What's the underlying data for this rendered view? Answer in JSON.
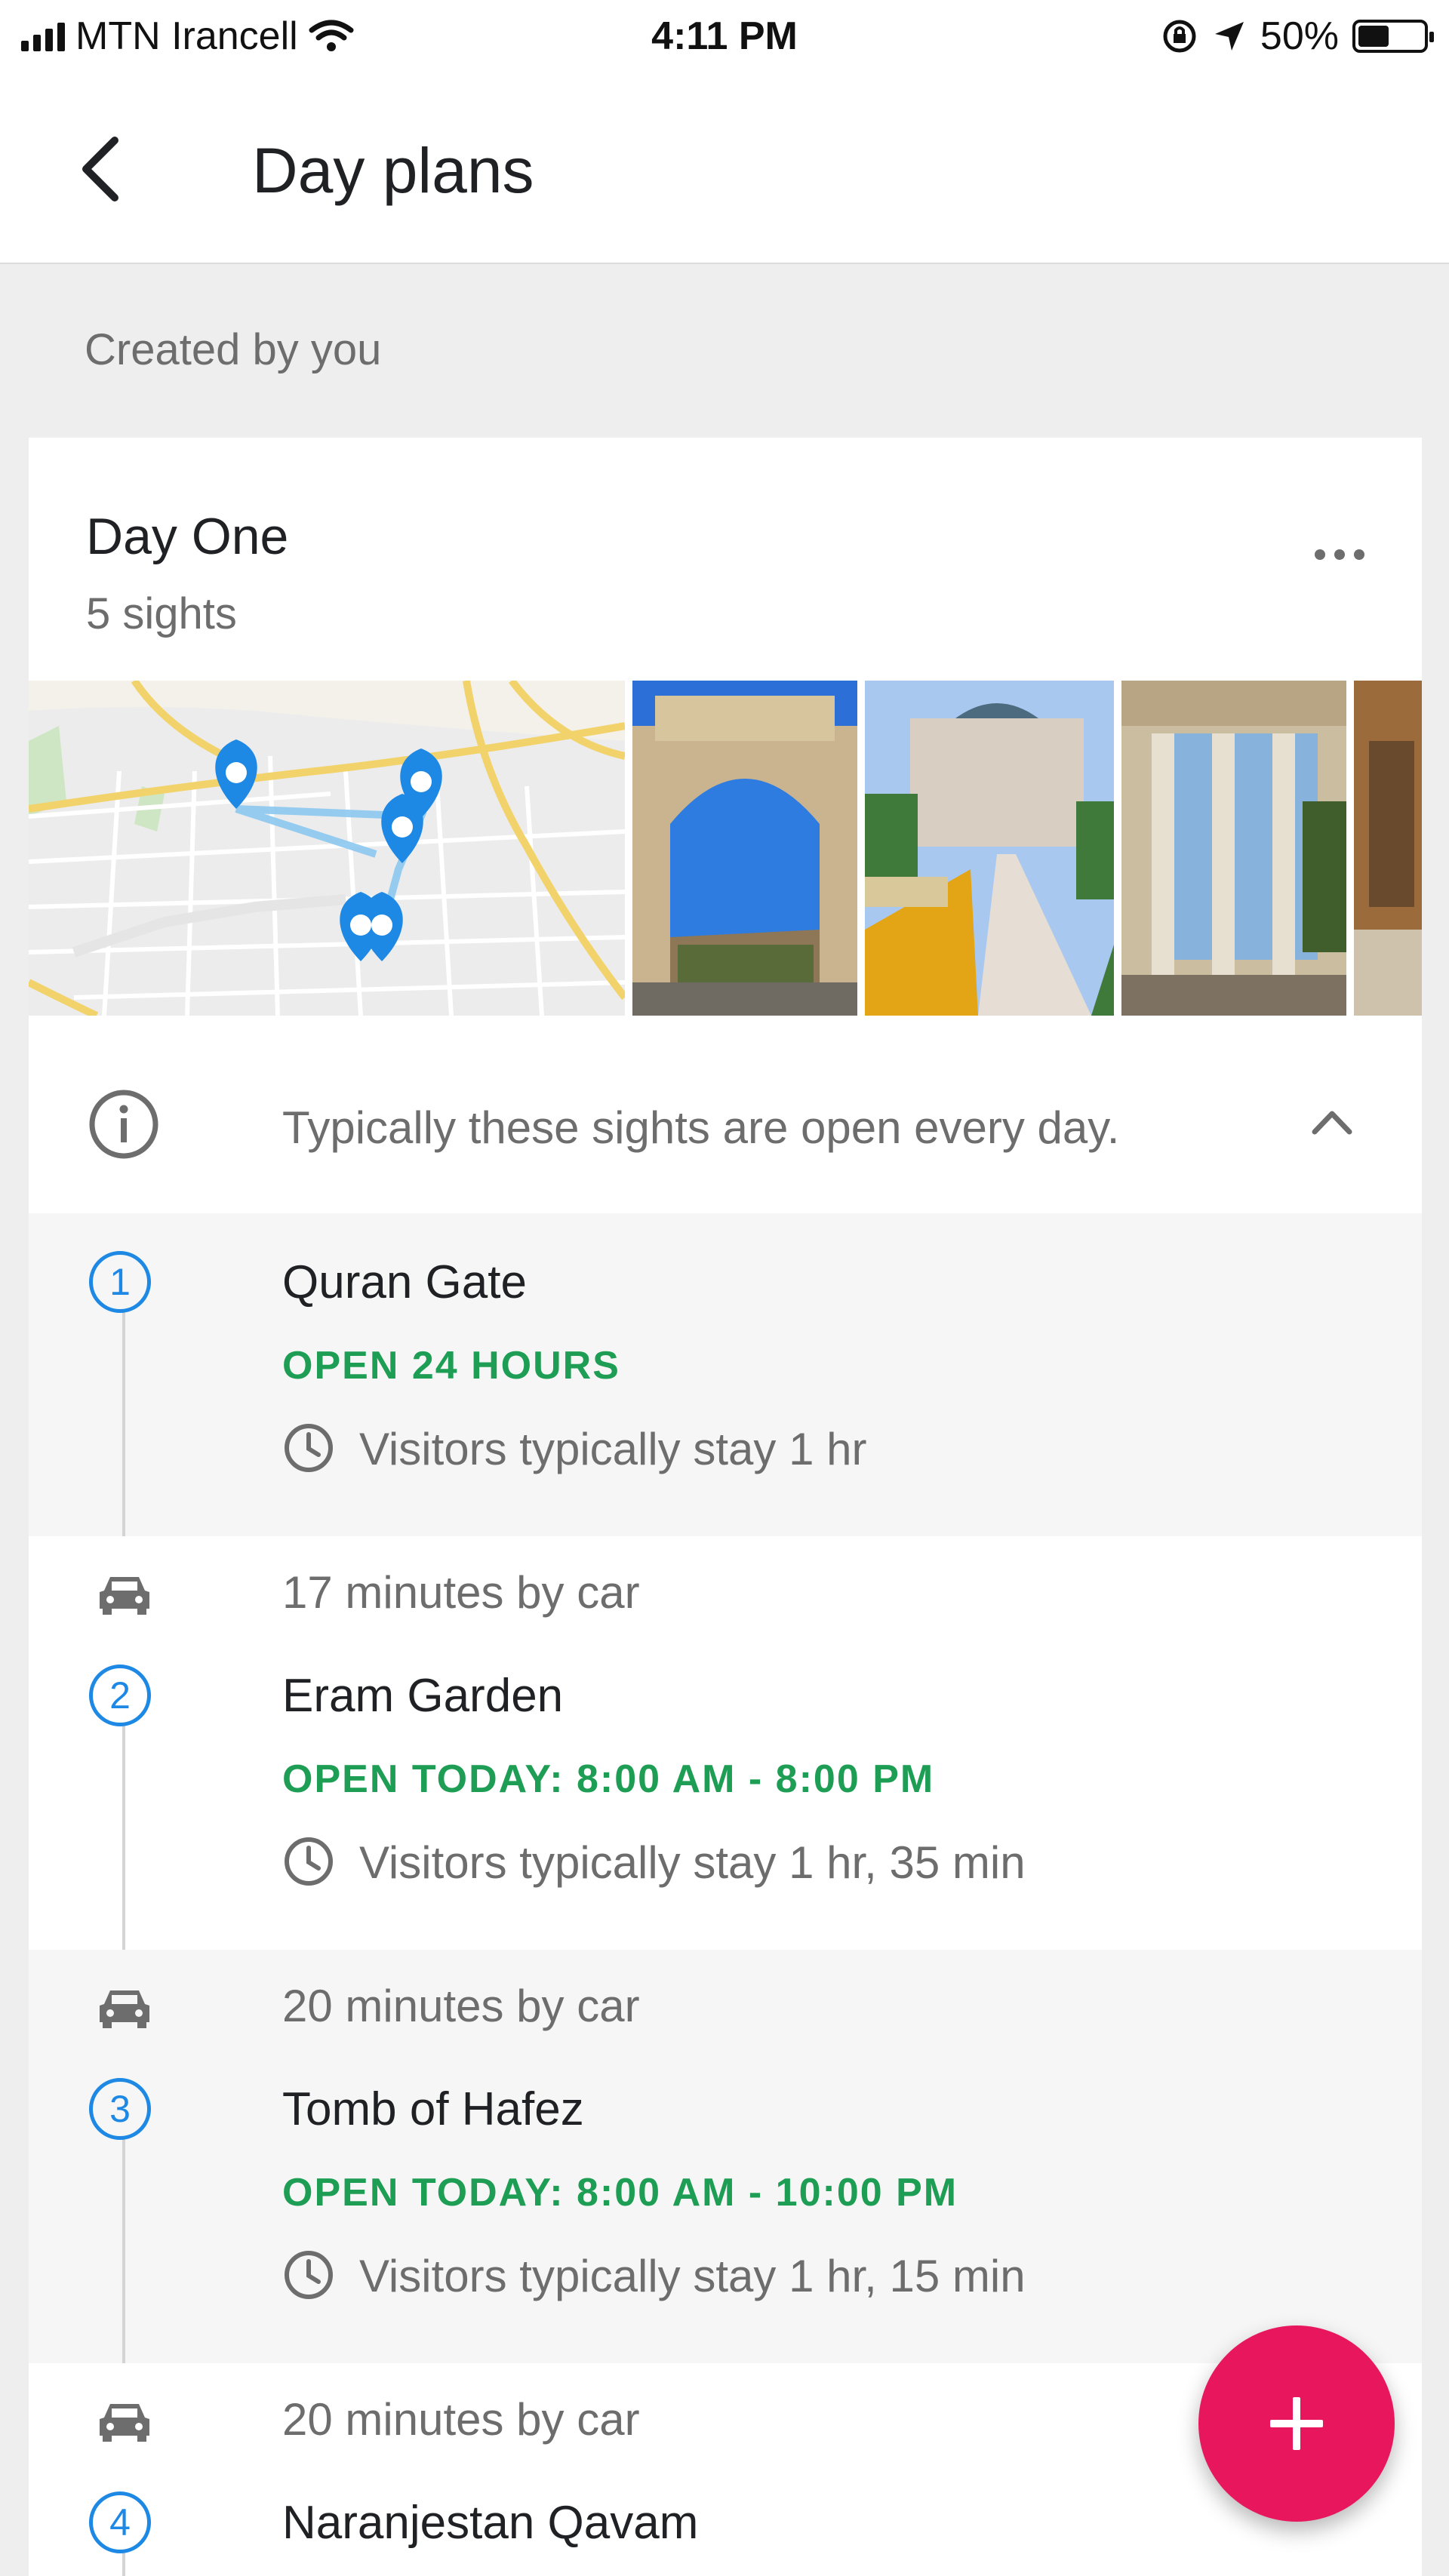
{
  "status_bar": {
    "carrier": "MTN Irancell",
    "time": "4:11 PM",
    "battery": "50%",
    "battery_level": 0.5
  },
  "app_bar": {
    "title": "Day plans"
  },
  "section_label": "Created by you",
  "plan": {
    "title": "Day One",
    "subtitle": "5 sights"
  },
  "info": {
    "text": "Typically these sights are open every day."
  },
  "stops": [
    {
      "number": "1",
      "travel": "",
      "name": "Quran Gate",
      "hours": "OPEN 24 HOURS",
      "stay": "Visitors typically stay 1 hr"
    },
    {
      "number": "2",
      "travel": "17 minutes by car",
      "name": "Eram Garden",
      "hours": "OPEN TODAY: 8:00 AM - 8:00 PM",
      "stay": "Visitors typically stay 1 hr, 35 min"
    },
    {
      "number": "3",
      "travel": "20 minutes by car",
      "name": "Tomb of Hafez",
      "hours": "OPEN TODAY: 8:00 AM - 10:00 PM",
      "stay": "Visitors typically stay 1 hr, 15 min"
    },
    {
      "number": "4",
      "travel": "20 minutes by car",
      "name": "Naranjestan Qavam",
      "hours": "",
      "stay": ""
    }
  ],
  "colors": {
    "accent_blue": "#1e88e5",
    "open_green": "#1e9e54",
    "fab_pink": "#e8175d"
  },
  "icons": [
    "back-arrow-icon",
    "more-icon",
    "info-icon",
    "chevron-up-icon",
    "car-icon",
    "clock-icon",
    "plus-icon",
    "wifi-icon",
    "location-arrow-icon",
    "rotation-lock-icon"
  ]
}
